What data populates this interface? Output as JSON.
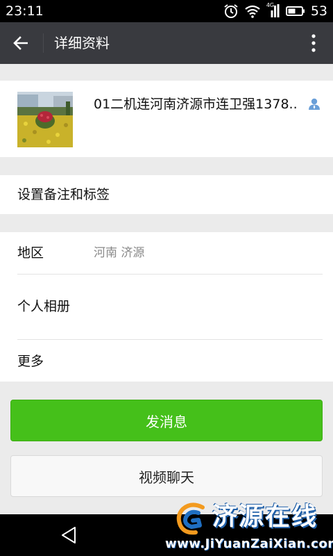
{
  "status_bar": {
    "time": "23:11",
    "network": "4G",
    "battery": "53",
    "icons": [
      "alarm-icon",
      "wifi-icon",
      "signal-icon",
      "battery-icon"
    ]
  },
  "header": {
    "title": "详细资料",
    "back_icon": "back-arrow-icon",
    "more_icon": "more-vertical-icon"
  },
  "profile": {
    "name": "01二机连河南济源市连卫强1378..",
    "contact_icon": "contact-person-icon"
  },
  "remark": {
    "label": "设置备注和标签"
  },
  "info": {
    "region_label": "地区",
    "region_value": "河南  济源",
    "album_label": "个人相册",
    "more_label": "更多"
  },
  "actions": {
    "send_message": "发消息",
    "video_chat": "视频聊天"
  },
  "watermark": {
    "title": "济源在线",
    "url": "www.JiYuanZaiXian.com"
  },
  "colors": {
    "header_bg": "#393a3f",
    "accent_green": "#45c01a",
    "page_bg": "#ebebeb"
  }
}
